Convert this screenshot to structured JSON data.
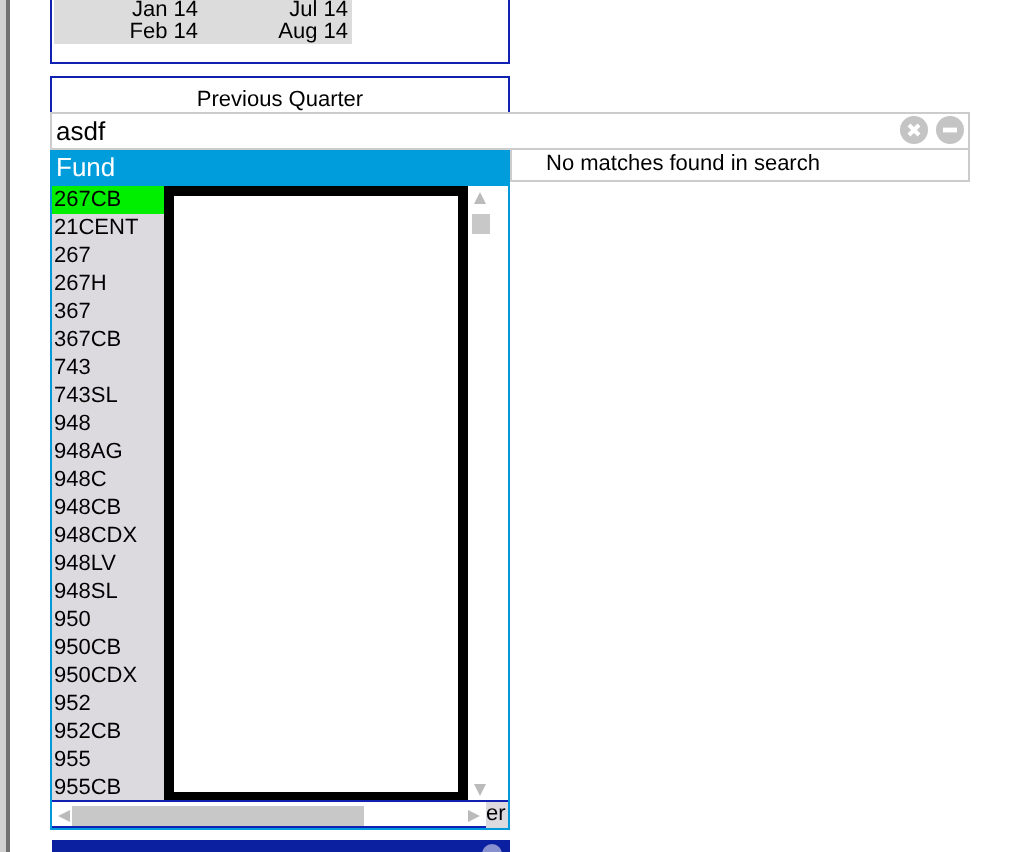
{
  "period_panel": {
    "rows": [
      {
        "start": "Jan 14",
        "end": "Jul 14"
      },
      {
        "start": "Feb 14",
        "end": "Aug 14"
      }
    ]
  },
  "quarter_panel": {
    "label": "Previous Quarter"
  },
  "search": {
    "value": "asdf"
  },
  "fund_list": {
    "header": "Fund",
    "trailing_text": "er",
    "items": [
      {
        "label": "267CB",
        "selected": true
      },
      {
        "label": "21CENT",
        "selected": false
      },
      {
        "label": "267",
        "selected": false
      },
      {
        "label": "267H",
        "selected": false
      },
      {
        "label": "367",
        "selected": false
      },
      {
        "label": "367CB",
        "selected": false
      },
      {
        "label": "743",
        "selected": false
      },
      {
        "label": "743SL",
        "selected": false
      },
      {
        "label": "948",
        "selected": false
      },
      {
        "label": "948AG",
        "selected": false
      },
      {
        "label": "948C",
        "selected": false
      },
      {
        "label": "948CB",
        "selected": false
      },
      {
        "label": "948CDX",
        "selected": false
      },
      {
        "label": "948LV",
        "selected": false
      },
      {
        "label": "948SL",
        "selected": false
      },
      {
        "label": "950",
        "selected": false
      },
      {
        "label": "950CB",
        "selected": false
      },
      {
        "label": "950CDX",
        "selected": false
      },
      {
        "label": "952",
        "selected": false
      },
      {
        "label": "952CB",
        "selected": false
      },
      {
        "label": "955",
        "selected": false
      },
      {
        "label": "955CB",
        "selected": false
      }
    ]
  },
  "message": "No matches found in search"
}
